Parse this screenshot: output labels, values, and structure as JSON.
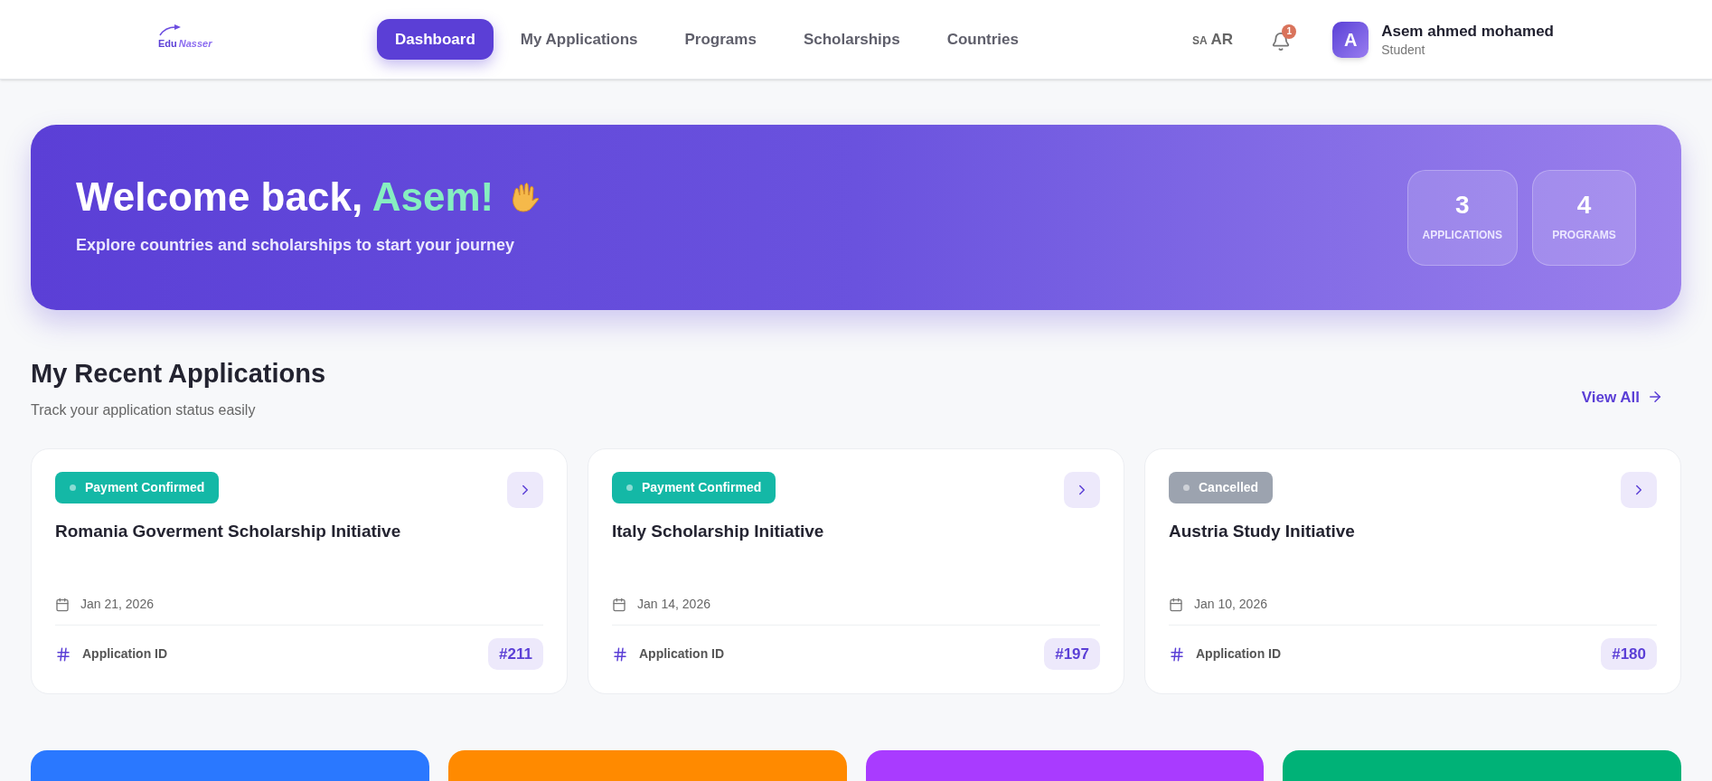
{
  "header": {
    "logo": {
      "part_1": "Edu",
      "part_2": "Nasser"
    },
    "nav": [
      {
        "label": "Dashboard",
        "selected": true
      },
      {
        "label": "My Applications",
        "selected": false
      },
      {
        "label": "Programs",
        "selected": false
      },
      {
        "label": "Scholarships",
        "selected": false
      },
      {
        "label": "Countries",
        "selected": false
      }
    ],
    "language": {
      "code": "SA",
      "label": "AR"
    },
    "notifications": {
      "count": "1"
    },
    "user": {
      "initial": "A",
      "name": "Asem ahmed mohamed",
      "role": "Student"
    }
  },
  "hero": {
    "greeting": "Welcome back,",
    "name": "Asem!",
    "subtitle": "Explore countries and scholarships to start your journey",
    "stats": [
      {
        "value": "3",
        "label": "APPLICATIONS"
      },
      {
        "value": "4",
        "label": "PROGRAMS"
      }
    ]
  },
  "recent": {
    "title": "My Recent Applications",
    "subtitle": "Track your application status easily",
    "view_all": "View All",
    "applications": [
      {
        "status": "Payment Confirmed",
        "color": "#14b8a6",
        "title": "Romania Goverment Scholarship Initiative",
        "date": "Jan 21, 2026",
        "id_label": "Application ID",
        "id": "#211"
      },
      {
        "status": "Payment Confirmed",
        "color": "#14b8a6",
        "title": "Italy Scholarship Initiative",
        "date": "Jan 14, 2026",
        "id_label": "Application ID",
        "id": "#197"
      },
      {
        "status": "Cancelled",
        "color": "#9ca3af",
        "title": "Austria Study Initiative",
        "date": "Jan 10, 2026",
        "id_label": "Application ID",
        "id": "#180"
      }
    ]
  },
  "quick_cards": [
    {
      "color": "#2a78ff"
    },
    {
      "color": "#ff8a00"
    },
    {
      "color": "#a93bff"
    },
    {
      "color": "#00b277"
    }
  ]
}
